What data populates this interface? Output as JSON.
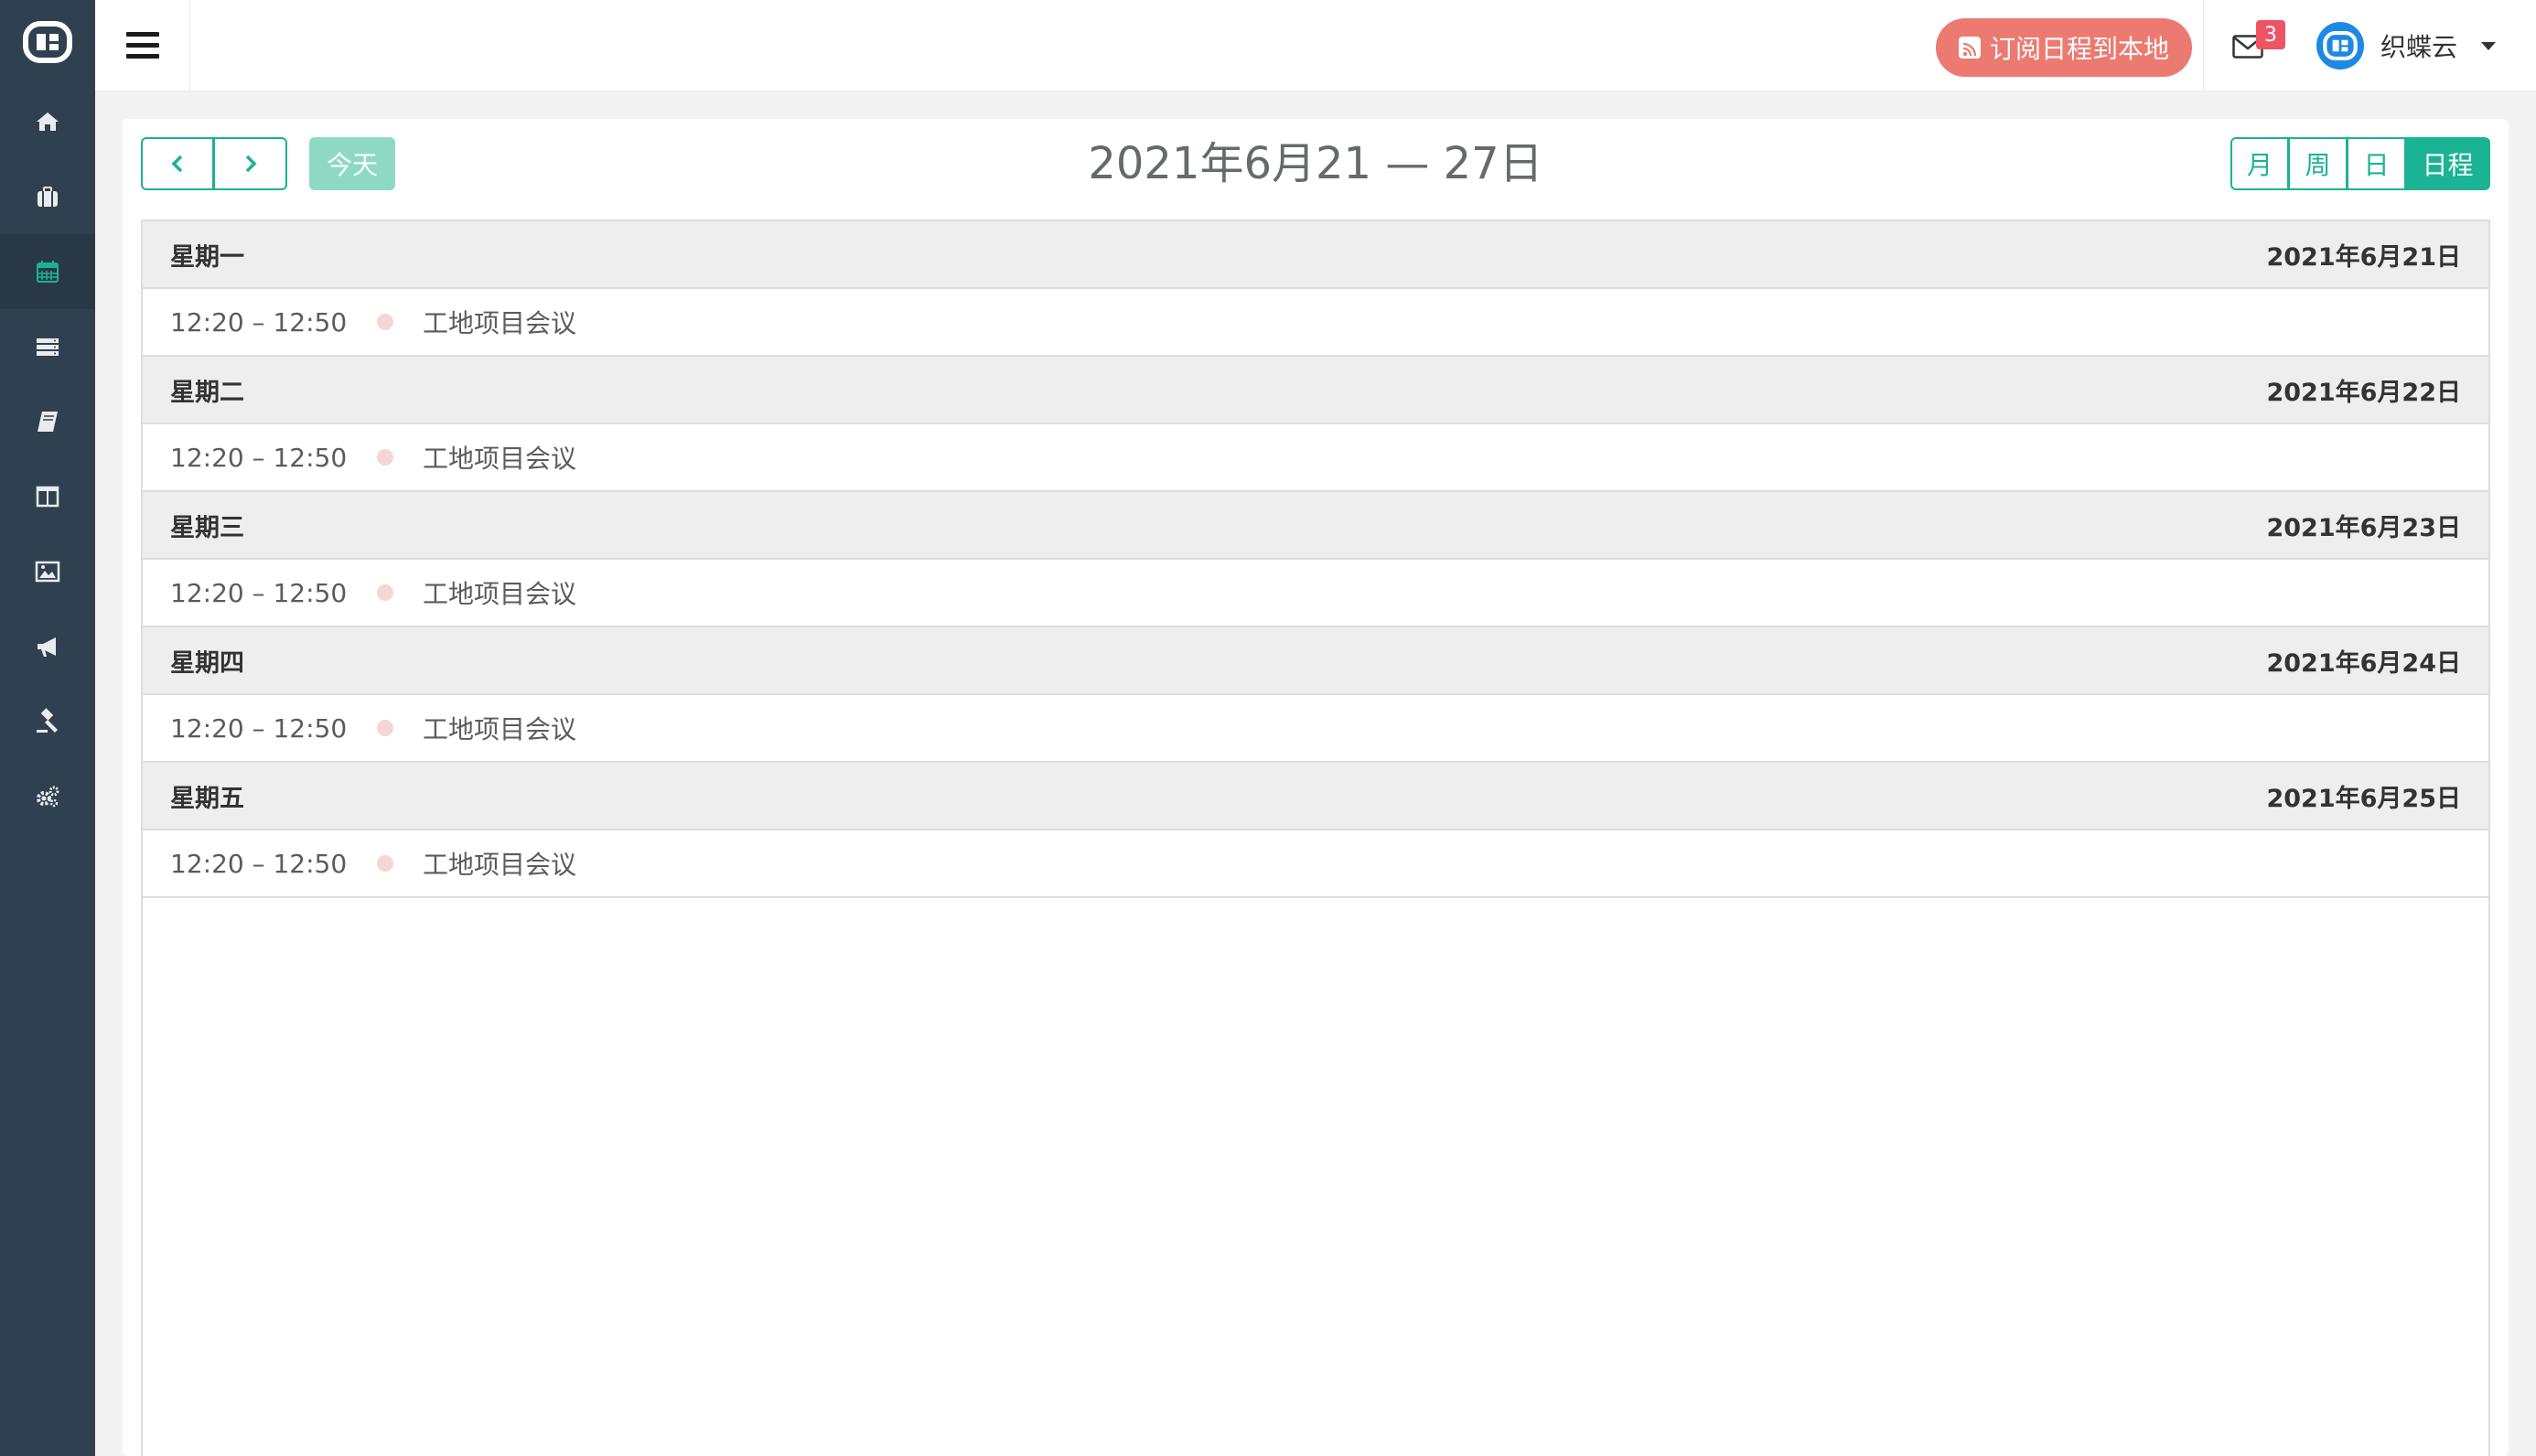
{
  "topbar": {
    "subscribe_label": "订阅日程到本地",
    "mail_count": "3",
    "user_name": "织蝶云"
  },
  "toolbar": {
    "today_label": "今天",
    "title": "2021年6月21 — 27日",
    "views": [
      "月",
      "周",
      "日",
      "日程"
    ],
    "active_view": "日程"
  },
  "sidebar": {
    "items": [
      "home-icon",
      "briefcase-icon",
      "calendar-icon",
      "server-icon",
      "book-icon",
      "columns-icon",
      "image-icon",
      "bullhorn-icon",
      "gavel-icon",
      "gears-icon"
    ],
    "active": "calendar-icon"
  },
  "days": [
    {
      "weekday": "星期一",
      "date": "2021年6月21日",
      "event": {
        "time": "12:20 – 12:50",
        "title": "工地项目会议"
      }
    },
    {
      "weekday": "星期二",
      "date": "2021年6月22日",
      "event": {
        "time": "12:20 – 12:50",
        "title": "工地项目会议"
      }
    },
    {
      "weekday": "星期三",
      "date": "2021年6月23日",
      "event": {
        "time": "12:20 – 12:50",
        "title": "工地项目会议"
      }
    },
    {
      "weekday": "星期四",
      "date": "2021年6月24日",
      "event": {
        "time": "12:20 – 12:50",
        "title": "工地项目会议"
      }
    },
    {
      "weekday": "星期五",
      "date": "2021年6月25日",
      "event": {
        "time": "12:20 – 12:50",
        "title": "工地项目会议"
      }
    }
  ],
  "colors": {
    "accent": "#1ab394",
    "sidebar": "#2f4050",
    "subscribe": "#ec7a70",
    "event_dot": "#f3d6d5"
  }
}
